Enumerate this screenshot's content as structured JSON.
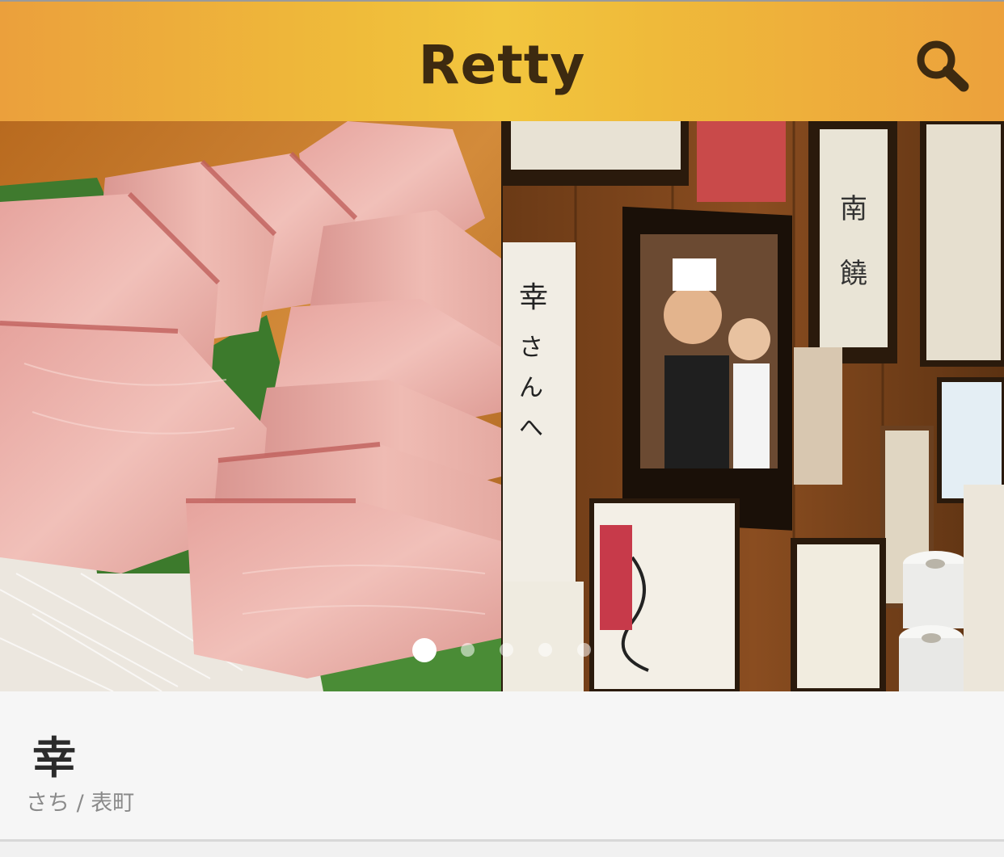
{
  "header": {
    "logo_text": "Retty",
    "search_icon": "search-icon",
    "colors": {
      "bar_edge": "#eba03c",
      "bar_center": "#f2c63e",
      "logo": "#3d2a10"
    }
  },
  "gallery": {
    "slide_count": 5,
    "active_index": 0,
    "photos": [
      "sashimi-photo",
      "restaurant-wall-photo"
    ]
  },
  "restaurant": {
    "name": "幸",
    "reading": "さち",
    "separator": "/",
    "area": "表町"
  }
}
